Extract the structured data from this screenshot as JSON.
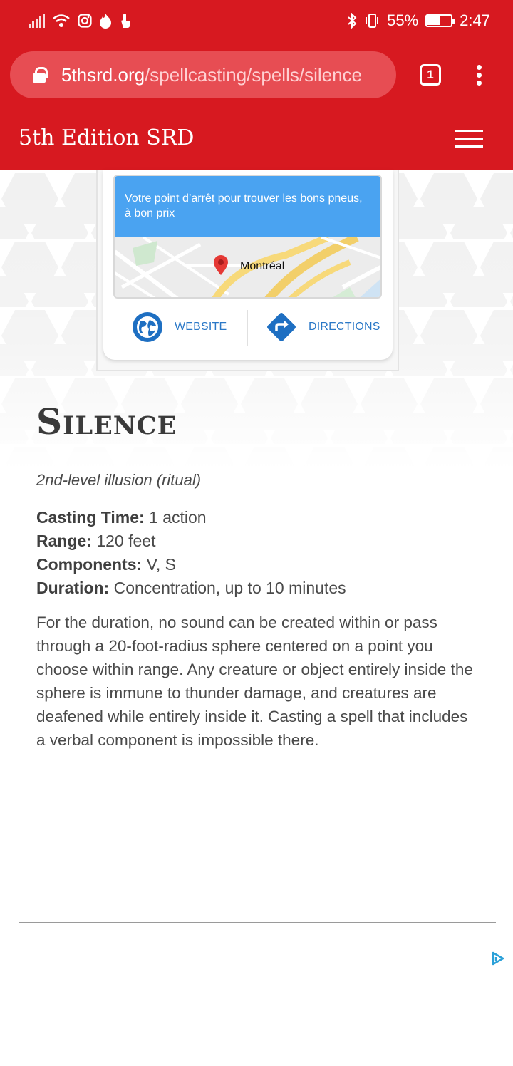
{
  "status_bar": {
    "battery_percent": "55%",
    "battery_level": 0.55,
    "time": "2:47",
    "icons": [
      "signal-icon",
      "wifi-icon",
      "instagram-icon",
      "tinder-icon",
      "touch-icon",
      "bluetooth-icon",
      "vibrate-icon",
      "battery-icon"
    ]
  },
  "browser": {
    "url_host": "5thsrd.org",
    "url_path": "/spellcasting/spells/silence",
    "tab_count": "1"
  },
  "site": {
    "title": "5th Edition SRD"
  },
  "ad": {
    "banner_text": "Votre point d’arrêt pour trouver les bons pneus, à bon prix",
    "map_location": "Montréal",
    "website_label": "WEBSITE",
    "directions_label": "DIRECTIONS"
  },
  "spell": {
    "name": "Silence",
    "subtitle": "2nd-level illusion (ritual)",
    "casting_time_label": "Casting Time:",
    "casting_time": " 1 action",
    "range_label": "Range:",
    "range": " 120 feet",
    "components_label": "Components:",
    "components": " V, S",
    "duration_label": "Duration:",
    "duration": " Concentration, up to 10 minutes",
    "description": "For the duration, no sound can be created within or pass through a 20-foot-radius sphere centered on a point you choose within range. Any creature or object entirely inside the sphere is immune to thunder damage, and creatures are deafened while entirely inside it. Casting a spell that includes a verbal component is impossible there."
  },
  "colors": {
    "brand_red": "#d71920",
    "ad_blue": "#4aa3f1",
    "link_blue": "#2a78c7"
  }
}
